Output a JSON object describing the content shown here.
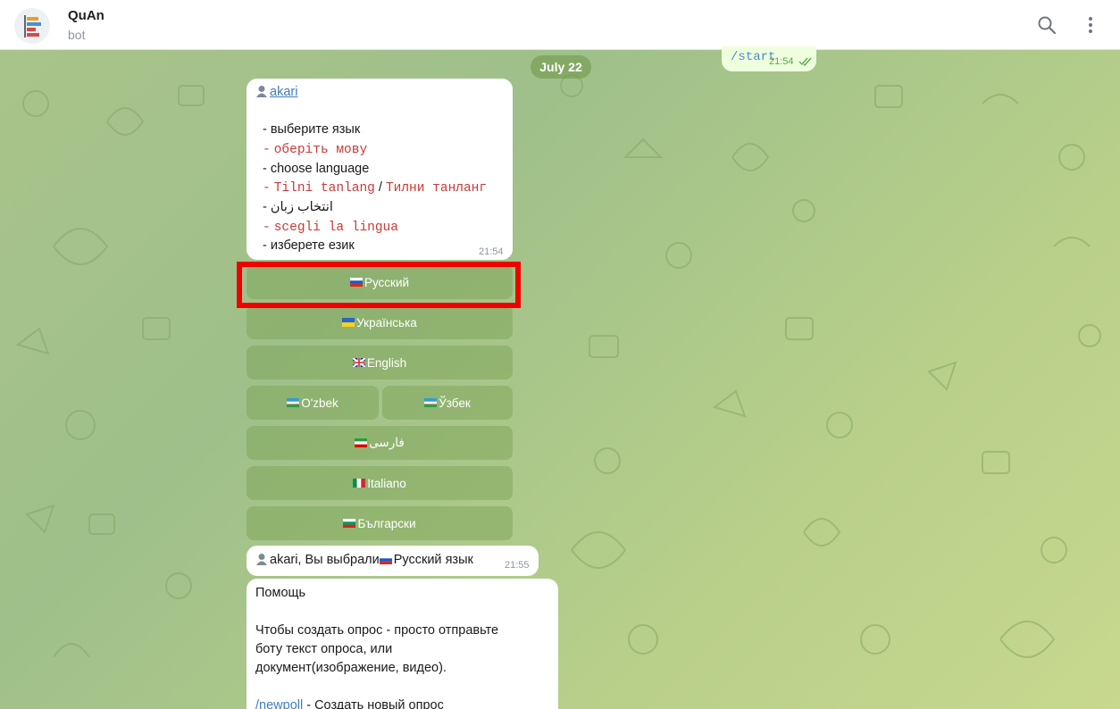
{
  "header": {
    "title": "QuAn",
    "subtitle": "bot",
    "search_icon": "search-icon",
    "menu_icon": "more-vertical-icon"
  },
  "date_separator": "July 22",
  "outgoing": {
    "text": "/start",
    "time": "21:54"
  },
  "language_message": {
    "mention": "akari",
    "lines": [
      "- выберите язык",
      "оберіть мову",
      "- choose language",
      "Tilni tanlang",
      "Тилни танланг",
      "- انتخاب زبان",
      "scegli la lingua",
      "- изберете език"
    ],
    "dash": "-",
    "slash": "/",
    "time": "21:54"
  },
  "keyboard": {
    "russian": "Русский",
    "ukrainian": "Українська",
    "english": "English",
    "uzbek_latin": "O'zbek",
    "uzbek_cyrillic": "Ўзбек",
    "farsi": "فارسی",
    "italian": "Italiano",
    "bulgarian": "Български"
  },
  "selection_message": {
    "prefix": "akari, Вы выбрали",
    "suffix": "Русский язык",
    "time": "21:55"
  },
  "help_message": {
    "title": "Помощь",
    "line1": "Чтобы создать опрос - просто отправьте",
    "line2": "боту текст опроса, или",
    "line3": "документ(изображение, видео).",
    "command": "/newpoll",
    "command_desc": " - Создать новый опрос"
  },
  "colors": {
    "accent": "#3f7cc0",
    "highlight": "#f00000",
    "code_red": "#c83a3a",
    "outgoing_bg": "#eeffde"
  }
}
